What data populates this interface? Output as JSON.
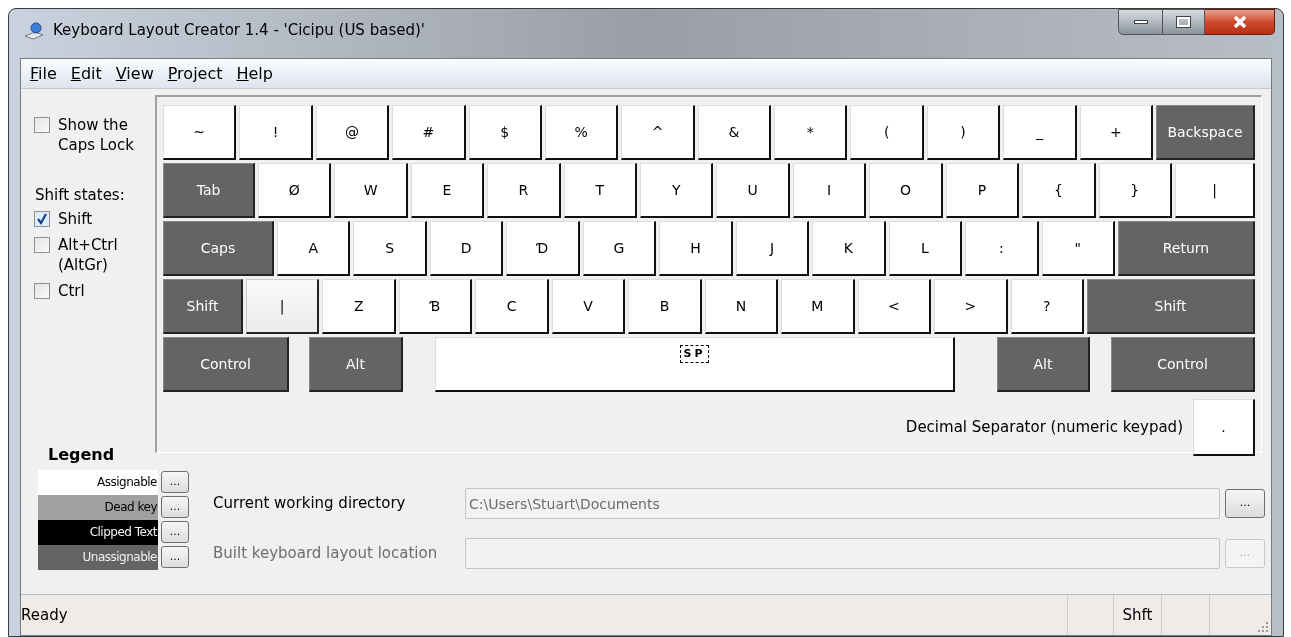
{
  "window": {
    "title": "Keyboard Layout Creator 1.4 - 'Cicipu (US based)'"
  },
  "menu": [
    {
      "label": "File"
    },
    {
      "label": "Edit"
    },
    {
      "label": "View"
    },
    {
      "label": "Project"
    },
    {
      "label": "Help"
    }
  ],
  "caps_lock_option": {
    "label": "Show the Caps Lock",
    "checked": false
  },
  "shift_states": {
    "title": "Shift states:",
    "options": [
      {
        "label": "Shift",
        "checked": true
      },
      {
        "label": "Alt+Ctrl (AltGr)",
        "checked": false
      },
      {
        "label": "Ctrl",
        "checked": false
      }
    ]
  },
  "keyboard": {
    "rows": [
      [
        {
          "label": "~",
          "kind": "assignable"
        },
        {
          "label": "!",
          "kind": "assignable"
        },
        {
          "label": "@",
          "kind": "assignable"
        },
        {
          "label": "#",
          "kind": "assignable"
        },
        {
          "label": "$",
          "kind": "assignable"
        },
        {
          "label": "%",
          "kind": "assignable"
        },
        {
          "label": "^",
          "kind": "assignable"
        },
        {
          "label": "&",
          "kind": "assignable"
        },
        {
          "label": "*",
          "kind": "assignable"
        },
        {
          "label": "(",
          "kind": "assignable"
        },
        {
          "label": ")",
          "kind": "assignable"
        },
        {
          "label": "_",
          "kind": "assignable"
        },
        {
          "label": "+",
          "kind": "assignable"
        },
        {
          "label": "Backspace",
          "kind": "unassignable"
        }
      ],
      [
        {
          "label": "Tab",
          "kind": "unassignable"
        },
        {
          "label": "Ø",
          "kind": "assignable"
        },
        {
          "label": "W",
          "kind": "assignable"
        },
        {
          "label": "E",
          "kind": "assignable"
        },
        {
          "label": "R",
          "kind": "assignable"
        },
        {
          "label": "T",
          "kind": "assignable"
        },
        {
          "label": "Y",
          "kind": "assignable"
        },
        {
          "label": "U",
          "kind": "assignable"
        },
        {
          "label": "I",
          "kind": "assignable"
        },
        {
          "label": "O",
          "kind": "assignable"
        },
        {
          "label": "P",
          "kind": "assignable"
        },
        {
          "label": "{",
          "kind": "assignable"
        },
        {
          "label": "}",
          "kind": "assignable"
        },
        {
          "label": "|",
          "kind": "assignable"
        }
      ],
      [
        {
          "label": "Caps",
          "kind": "unassignable"
        },
        {
          "label": "A",
          "kind": "assignable"
        },
        {
          "label": "S",
          "kind": "assignable"
        },
        {
          "label": "D",
          "kind": "assignable"
        },
        {
          "label": "Ɗ",
          "kind": "assignable"
        },
        {
          "label": "G",
          "kind": "assignable"
        },
        {
          "label": "H",
          "kind": "assignable"
        },
        {
          "label": "J",
          "kind": "assignable"
        },
        {
          "label": "K",
          "kind": "assignable"
        },
        {
          "label": "L",
          "kind": "assignable"
        },
        {
          "label": ":",
          "kind": "assignable"
        },
        {
          "label": "\"",
          "kind": "assignable"
        },
        {
          "label": "Return",
          "kind": "unassignable"
        }
      ],
      [
        {
          "label": "Shift",
          "kind": "unassignable"
        },
        {
          "label": "|",
          "kind": "focused"
        },
        {
          "label": "Z",
          "kind": "assignable"
        },
        {
          "label": "Ɓ",
          "kind": "assignable"
        },
        {
          "label": "C",
          "kind": "assignable"
        },
        {
          "label": "V",
          "kind": "assignable"
        },
        {
          "label": "B",
          "kind": "assignable"
        },
        {
          "label": "N",
          "kind": "assignable"
        },
        {
          "label": "M",
          "kind": "assignable"
        },
        {
          "label": "<",
          "kind": "assignable"
        },
        {
          "label": ">",
          "kind": "assignable"
        },
        {
          "label": "?",
          "kind": "assignable"
        },
        {
          "label": "Shift",
          "kind": "unassignable"
        }
      ],
      [
        {
          "label": "Control",
          "kind": "unassignable"
        },
        {
          "label": "Alt",
          "kind": "unassignable"
        },
        {
          "label": "SP",
          "kind": "whitespace"
        },
        {
          "label": "Alt",
          "kind": "unassignable"
        },
        {
          "label": "Control",
          "kind": "unassignable"
        }
      ]
    ]
  },
  "decimal_separator": {
    "label": "Decimal Separator (numeric keypad)",
    "key": {
      "label": ".",
      "kind": "assignable"
    }
  },
  "legend": {
    "title": "Legend",
    "items": [
      {
        "label": "Assignable",
        "color": "#ffffff",
        "button": "..."
      },
      {
        "label": "Dead key",
        "color": "#a0a0a0",
        "button": "..."
      },
      {
        "label": "Clipped Text",
        "color": "#000000",
        "button": "..."
      },
      {
        "label": "Unassignable",
        "color": "#646464",
        "button": "..."
      }
    ]
  },
  "locations": [
    {
      "label": "Current working directory",
      "value": "C:\\Users\\Stuart\\Documents",
      "button": "...",
      "disabled": false
    },
    {
      "label": "Built keyboard layout location",
      "button": "...",
      "disabled": true
    }
  ],
  "status_bar": {
    "message": "Ready",
    "indicators": [
      "Shft"
    ]
  }
}
